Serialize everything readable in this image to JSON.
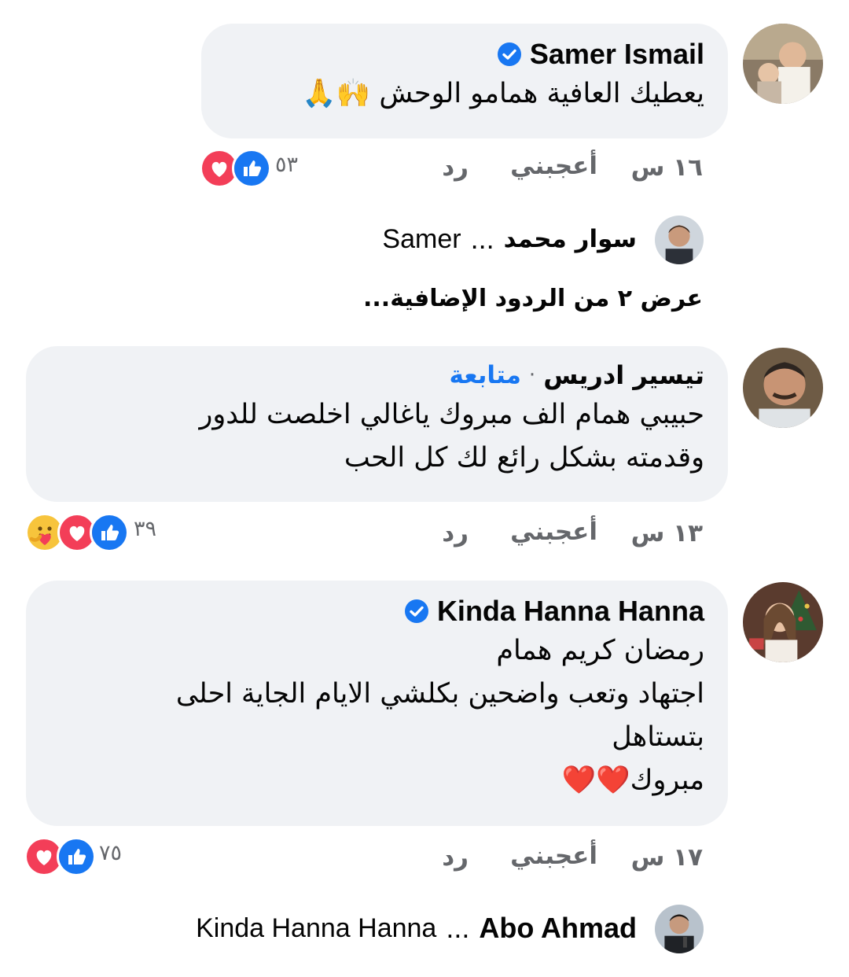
{
  "comments": [
    {
      "author": "Samer Ismail",
      "verified": true,
      "text_lines": [
        "يعطيك العافية همامو الوحش 🙌🙏"
      ],
      "time": "١٦ س",
      "like_label": "أعجبني",
      "reply_label": "رد",
      "reaction_count": "٥٣",
      "reactions": [
        "like-icon",
        "love-icon"
      ],
      "replies": [
        {
          "author": "سوار محمد",
          "ellipsis": "...",
          "mention": "Samer"
        }
      ],
      "more_replies": "عرض ٢ من الردود الإضافية..."
    },
    {
      "author": "تيسير ادريس",
      "verified": false,
      "follow_label": "متابعة",
      "separator": "·",
      "text_lines": [
        "حبيبي همام الف مبروك ياغالي اخلصت للدور",
        "وقدمته بشكل رائع لك كل الحب"
      ],
      "time": "١٣ س",
      "like_label": "أعجبني",
      "reply_label": "رد",
      "reaction_count": "٣٩",
      "reactions": [
        "like-icon",
        "love-icon",
        "care-icon"
      ]
    },
    {
      "author": "Kinda Hanna Hanna",
      "verified": true,
      "text_lines": [
        "رمضان كريم همام",
        "اجتهاد وتعب واضحين بكلشي  الايام الجاية احلى",
        "بتستاهل",
        "مبروك❤️❤️"
      ],
      "time": "١٧ س",
      "like_label": "أعجبني",
      "reply_label": "رد",
      "reaction_count": "٧٥",
      "reactions": [
        "like-icon",
        "love-icon"
      ],
      "replies": [
        {
          "author": "Abo Ahmad",
          "ellipsis": "...",
          "mention": "Kinda Hanna Hanna"
        }
      ]
    }
  ],
  "colors": {
    "bubble": "#f0f2f5",
    "text": "#050505",
    "meta": "#65676b",
    "link": "#1877f2",
    "verified": "#1877f2",
    "like": "#1877f2",
    "love": "#f33e58"
  }
}
